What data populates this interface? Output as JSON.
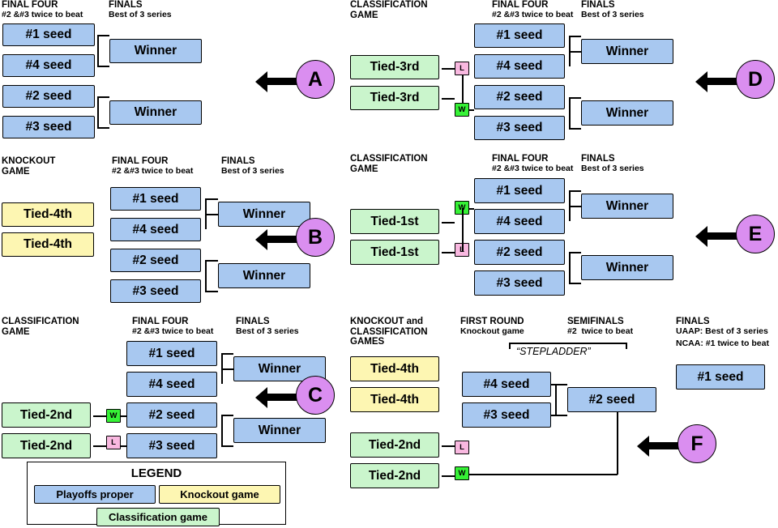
{
  "labels": {
    "final_four": "FINAL FOUR",
    "final_four_sub": "#2 &#3 twice to beat",
    "finals": "FINALS",
    "finals_sub": "Best of 3 series",
    "knockout_game": "KNOCKOUT\nGAME",
    "classification_game": "CLASSIFICATION\nGAME",
    "knockout_and_classification_games": "KNOCKOUT and\nCLASSIFICATION\nGAMES",
    "first_round": "FIRST ROUND",
    "first_round_sub": "Knockout game",
    "semifinals": "SEMIFINALS",
    "semifinals_sub": "#2  twice to beat",
    "finals_f_sub1": "UAAP: Best of 3 series",
    "finals_f_sub2": "NCAA: #1 twice to beat",
    "stepladder": "“STEPLADDER”"
  },
  "teams": {
    "seed1": "#1 seed",
    "seed2": "#2 seed",
    "seed3": "#3 seed",
    "seed4": "#4 seed",
    "winner": "Winner",
    "tied1st": "Tied-1st",
    "tied2nd": "Tied-2nd",
    "tied3rd": "Tied-3rd",
    "tied4th": "Tied-4th"
  },
  "wl": {
    "w": "W",
    "l": "L"
  },
  "scenarios": [
    {
      "id": "A",
      "letter": "A"
    },
    {
      "id": "B",
      "letter": "B"
    },
    {
      "id": "C",
      "letter": "C"
    },
    {
      "id": "D",
      "letter": "D"
    },
    {
      "id": "E",
      "letter": "E"
    },
    {
      "id": "F",
      "letter": "F"
    }
  ],
  "legend": {
    "title": "LEGEND",
    "playoffs_proper": "Playoffs proper",
    "knockout_game": "Knockout game",
    "classification_game": "Classification game"
  },
  "colors": {
    "playoffs_proper": "#a8c8f0",
    "knockout_game": "#fdf6b2",
    "classification_game": "#caf5cc",
    "win": "#36f236",
    "loss": "#f9b8e0",
    "scenario_circle": "#da8ef0"
  }
}
